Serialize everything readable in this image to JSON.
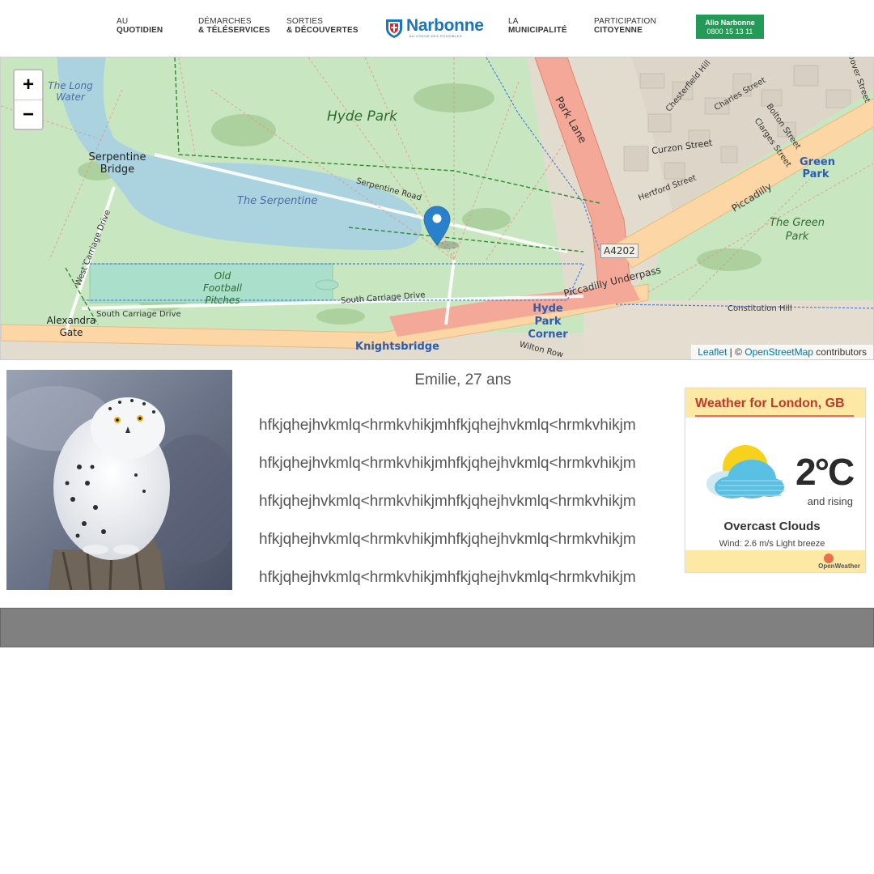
{
  "nav": {
    "items": [
      {
        "line1": "AU",
        "line2": "QUOTIDIEN"
      },
      {
        "line1": "DÉMARCHES",
        "line2": "& TÉLÉSERVICES"
      },
      {
        "line1": "SORTIES",
        "line2": "& DÉCOUVERTES"
      },
      {
        "line1": "LA",
        "line2": "MUNICIPALITÉ"
      },
      {
        "line1": "PARTICIPATION",
        "line2": "CITOYENNE"
      }
    ],
    "logo": {
      "name": "Narbonne",
      "tagline": "AU COEUR DES POSSIBLES"
    },
    "allo": {
      "title": "Allo Narbonne",
      "phone": "0800 15 13 11"
    }
  },
  "map": {
    "zoom_in": "+",
    "zoom_out": "−",
    "attribution": {
      "leaflet": "Leaflet",
      "sep": " | © ",
      "osm": "OpenStreetMap",
      "suffix": " contributors"
    },
    "labels": {
      "long_water": "The Long Water",
      "hyde_park": "Hyde Park",
      "serpentine_bridge": "Serpentine Bridge",
      "serpentine": "The Serpentine",
      "serpentine_road": "Serpentine Road",
      "park_lane": "Park Lane",
      "curzon": "Curzon Street",
      "hertford": "Hertford Street",
      "piccadilly": "Piccadilly",
      "green_park": "Green Park",
      "the_green_park": "The Green Park",
      "a4202": "A4202",
      "piccadilly_underpass": "Piccadilly Underpass",
      "old_football": "Old Football Pitches",
      "south_carriage": "South Carriage Drive",
      "south_carriage_2": "South Carriage Drive",
      "west_carriage": "West Carriage Drive",
      "alexandra_gate": "Alexandra Gate",
      "hyde_park_corner": "Hyde Park Corner",
      "knightsbridge": "Knightsbridge",
      "constitution_hill": "Constitution Hill",
      "wilton_row": "Wilton Row",
      "chesterfield": "Chesterfield Hill",
      "charles": "Charles Street",
      "bolton": "Bolton Street",
      "clarges": "Clarges Street",
      "dover": "Dover Street"
    }
  },
  "profile": {
    "caption": "Emilie, 27 ans",
    "lines": [
      "hfkjqhejhvkmlq<hrmkvhikjmhfkjqhejhvkmlq<hrmkvhikjm",
      "hfkjqhejhvkmlq<hrmkvhikjmhfkjqhejhvkmlq<hrmkvhikjm",
      "hfkjqhejhvkmlq<hrmkvhikjmhfkjqhejhvkmlq<hrmkvhikjm",
      "hfkjqhejhvkmlq<hrmkvhikjmhfkjqhejhvkmlq<hrmkvhikjm",
      "hfkjqhejhvkmlq<hrmkvhikjmhfkjqhejhvkmlq<hrmkvhikjm"
    ]
  },
  "weather": {
    "title": "Weather for London, GB",
    "temp": "2°C",
    "trend": "and rising",
    "description": "Overcast Clouds",
    "wind": "Wind: 2.6 m/s Light breeze",
    "brand": "OpenWeather"
  }
}
